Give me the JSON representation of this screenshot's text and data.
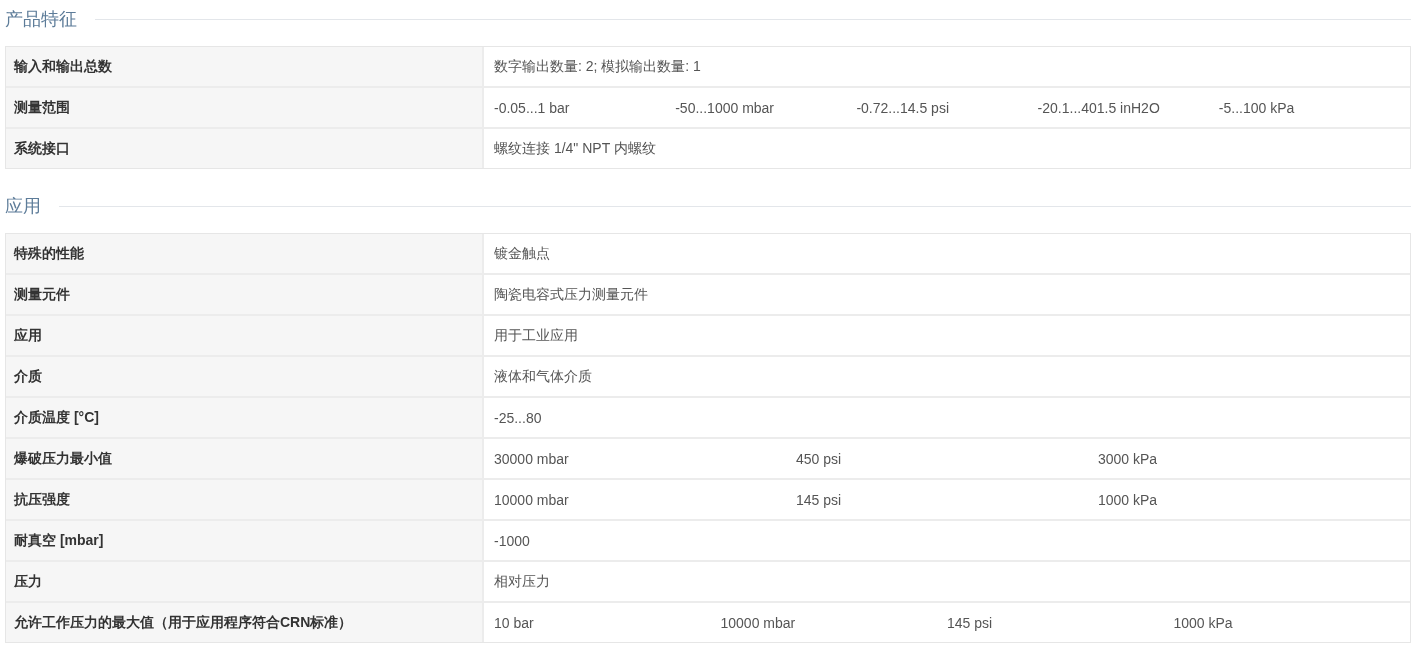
{
  "sections": [
    {
      "title": "产品特征",
      "rows": [
        {
          "label": "输入和输出总数",
          "values": [
            "数字输出数量: 2; 模拟输出数量: 1"
          ]
        },
        {
          "label": "测量范围",
          "values": [
            "-0.05...1 bar",
            "-50...1000 mbar",
            "-0.72...14.5 psi",
            "-20.1...401.5 inH2O",
            "-5...100 kPa"
          ]
        },
        {
          "label": "系统接口",
          "values": [
            "螺纹连接 1/4\" NPT 内螺纹"
          ]
        }
      ]
    },
    {
      "title": "应用",
      "rows": [
        {
          "label": "特殊的性能",
          "values": [
            "镀金触点"
          ]
        },
        {
          "label": "测量元件",
          "values": [
            "陶瓷电容式压力测量元件"
          ]
        },
        {
          "label": "应用",
          "values": [
            "用于工业应用"
          ]
        },
        {
          "label": "介质",
          "values": [
            "液体和气体介质"
          ]
        },
        {
          "label": "介质温度 [°C]",
          "values": [
            "-25...80"
          ]
        },
        {
          "label": "爆破压力最小值",
          "values": [
            "30000 mbar",
            "450 psi",
            "3000 kPa"
          ]
        },
        {
          "label": "抗压强度",
          "values": [
            "10000 mbar",
            "145 psi",
            "1000 kPa"
          ]
        },
        {
          "label": "耐真空 [mbar]",
          "values": [
            "-1000"
          ]
        },
        {
          "label": "压力",
          "values": [
            "相对压力"
          ]
        },
        {
          "label": "允许工作压力的最大值（用于应用程序符合CRN标准）",
          "values": [
            "10 bar",
            "10000 mbar",
            "145 psi",
            "1000 kPa"
          ]
        }
      ]
    }
  ]
}
